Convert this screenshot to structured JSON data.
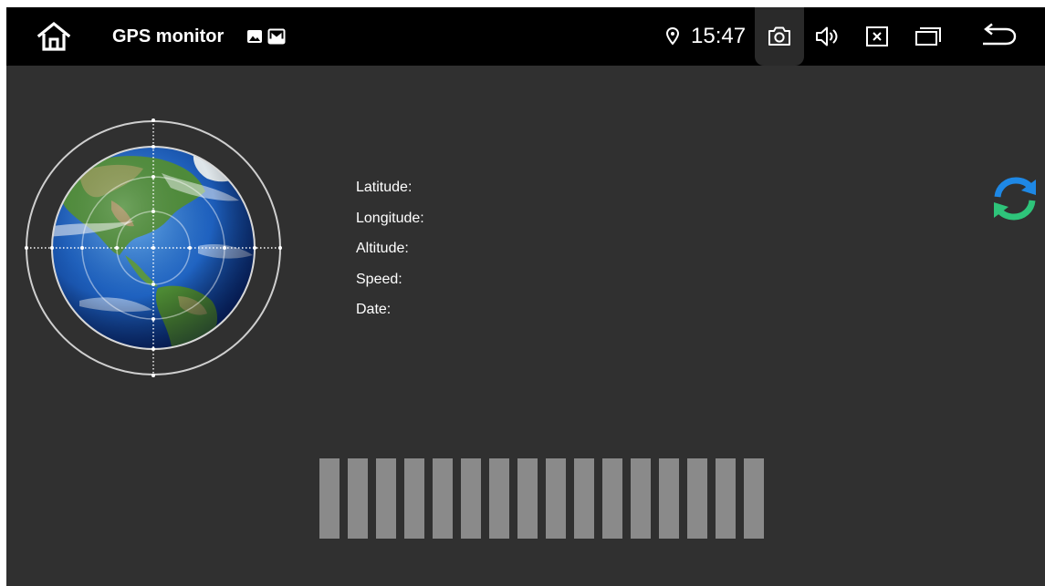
{
  "topbar": {
    "app_title": "GPS monitor",
    "notification_icons": [
      "image-notification-icon",
      "gallery-notification-icon"
    ],
    "location_icon": "location-pin-icon",
    "clock": "15:47",
    "buttons": {
      "home": "home-icon",
      "screenshot": "camera-icon",
      "volume": "volume-icon",
      "close": "close-box-icon",
      "recents": "recent-apps-icon",
      "back": "back-arrow-icon"
    }
  },
  "gps_info": {
    "rows": [
      {
        "label": "Latitude:",
        "value": ""
      },
      {
        "label": "Longitude:",
        "value": ""
      },
      {
        "label": "Altitude:",
        "value": ""
      },
      {
        "label": "Speed:",
        "value": ""
      },
      {
        "label": "Date:",
        "value": ""
      }
    ]
  },
  "refresh_icon": "refresh-icon",
  "signal_bars": {
    "count": 16,
    "color": "#8a8a8a"
  },
  "colors": {
    "background": "#303030",
    "topbar": "#000000",
    "refresh_blue": "#1e88e5",
    "refresh_green": "#2ec47a"
  }
}
